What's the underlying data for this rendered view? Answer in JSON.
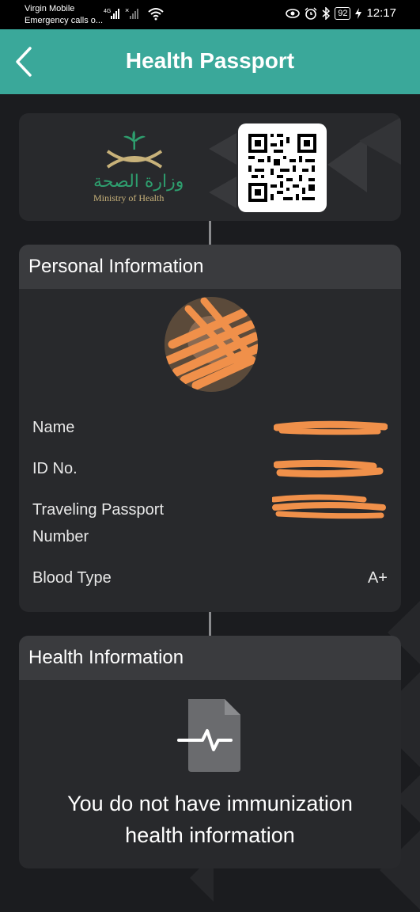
{
  "status_bar": {
    "carrier": "Virgin Mobile",
    "emergency": "Emergency calls o...",
    "network": "4G",
    "battery": "92",
    "time": "12:17"
  },
  "header": {
    "title": "Health Passport"
  },
  "logo": {
    "arabic": "وزارة الصحة",
    "english": "Ministry of Health"
  },
  "personal": {
    "title": "Personal Information",
    "rows": [
      {
        "label": "Name",
        "value": ""
      },
      {
        "label": "ID No.",
        "value": ""
      },
      {
        "label": "Traveling Passport Number",
        "value": ""
      },
      {
        "label": "Blood Type",
        "value": "A+"
      }
    ]
  },
  "health": {
    "title": "Health Information",
    "empty_message": "You do not have immunization health information"
  },
  "colors": {
    "accent": "#3aa89a",
    "background": "#1b1c1f",
    "card": "#28292c",
    "card_header": "#3a3b3e",
    "redaction": "#f0904a"
  }
}
